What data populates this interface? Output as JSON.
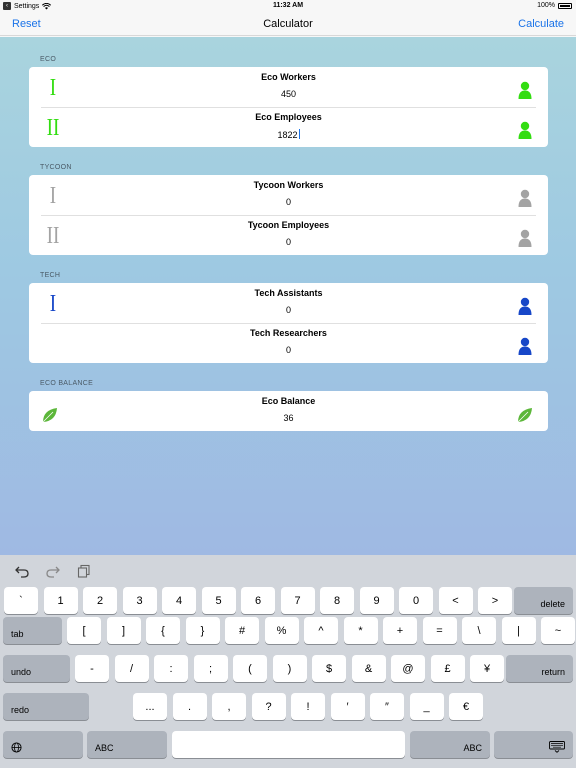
{
  "status_bar": {
    "back_label": "Settings",
    "time": "11:32 AM",
    "battery": "100%"
  },
  "nav": {
    "reset": "Reset",
    "title": "Calculator",
    "calculate": "Calculate"
  },
  "colors": {
    "eco": "#33dd11",
    "tycoon": "#a3a3a3",
    "tech": "#1747c8",
    "leaf": "#5cb73a",
    "accent": "#1a73e8"
  },
  "sections": {
    "eco": {
      "header": "ECO",
      "rows": [
        {
          "numeral": "I",
          "label": "Eco Workers",
          "value": "450",
          "icon": "person-icon"
        },
        {
          "numeral": "II",
          "label": "Eco Employees",
          "value": "1822",
          "icon": "person-icon"
        }
      ]
    },
    "tycoon": {
      "header": "TYCOON",
      "rows": [
        {
          "numeral": "I",
          "label": "Tycoon Workers",
          "value": "0",
          "icon": "person-icon"
        },
        {
          "numeral": "II",
          "label": "Tycoon Employees",
          "value": "0",
          "icon": "person-icon"
        }
      ]
    },
    "tech": {
      "header": "TECH",
      "rows": [
        {
          "numeral": "I",
          "label": "Tech Assistants",
          "value": "0",
          "icon": "person-icon"
        },
        {
          "numeral": "",
          "label": "Tech Researchers",
          "value": "0",
          "icon": "person-icon"
        }
      ]
    },
    "eco_balance": {
      "header": "ECO BALANCE",
      "rows": [
        {
          "label": "Eco Balance",
          "value": "36",
          "icon": "leaf-icon"
        }
      ]
    }
  },
  "keyboard": {
    "toolbar": [
      "undo-icon",
      "redo-icon",
      "paste-icon"
    ],
    "row1": [
      "`",
      "1",
      "2",
      "3",
      "4",
      "5",
      "6",
      "7",
      "8",
      "9",
      "0",
      "<",
      ">"
    ],
    "row1_special": "delete",
    "row2_special": "tab",
    "row2": [
      "[",
      "]",
      "{",
      "}",
      "#",
      "%",
      "^",
      "*",
      "+",
      "=",
      "\\",
      "|",
      "~"
    ],
    "row3_special_left": "undo",
    "row3": [
      "-",
      "/",
      ":",
      ";",
      "(",
      ")",
      "$",
      "&",
      "@",
      "£",
      "¥"
    ],
    "row3_special_right": "return",
    "row4_special_left": "redo",
    "row4": [
      "...",
      ".",
      ",",
      "?",
      "!",
      "′",
      "″",
      "_",
      "€"
    ],
    "row5": {
      "globe": "globe-icon",
      "abc_left": "ABC",
      "abc_right": "ABC",
      "dismiss": "keyboard-dismiss-icon"
    }
  }
}
